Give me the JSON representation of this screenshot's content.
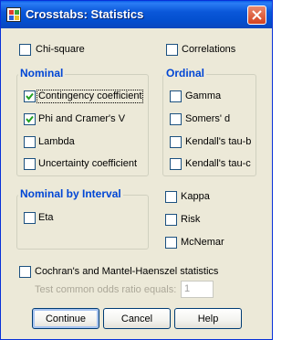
{
  "window": {
    "title": "Crosstabs: Statistics"
  },
  "top_options": {
    "chi_square": {
      "label": "Chi-square",
      "checked": false
    },
    "correlations": {
      "label": "Correlations",
      "checked": false
    }
  },
  "nominal": {
    "title": "Nominal",
    "items": [
      {
        "label": "Contingency coefficient",
        "checked": true
      },
      {
        "label": "Phi and Cramer's V",
        "checked": true
      },
      {
        "label": "Lambda",
        "checked": false
      },
      {
        "label": "Uncertainty coefficient",
        "checked": false
      }
    ]
  },
  "ordinal": {
    "title": "Ordinal",
    "items": [
      {
        "label": "Gamma",
        "checked": false
      },
      {
        "label": "Somers' d",
        "checked": false
      },
      {
        "label": "Kendall's tau-b",
        "checked": false
      },
      {
        "label": "Kendall's tau-c",
        "checked": false
      }
    ]
  },
  "nominal_by_interval": {
    "title": "Nominal by Interval",
    "items": [
      {
        "label": "Eta",
        "checked": false
      }
    ]
  },
  "other": {
    "items": [
      {
        "label": "Kappa",
        "checked": false
      },
      {
        "label": "Risk",
        "checked": false
      },
      {
        "label": "McNemar",
        "checked": false
      }
    ]
  },
  "cmh": {
    "label": "Cochran's and Mantel-Haenszel statistics",
    "checked": false,
    "odds_label": "Test common odds ratio equals:",
    "odds_value": "1"
  },
  "buttons": {
    "continue": "Continue",
    "cancel": "Cancel",
    "help": "Help"
  }
}
